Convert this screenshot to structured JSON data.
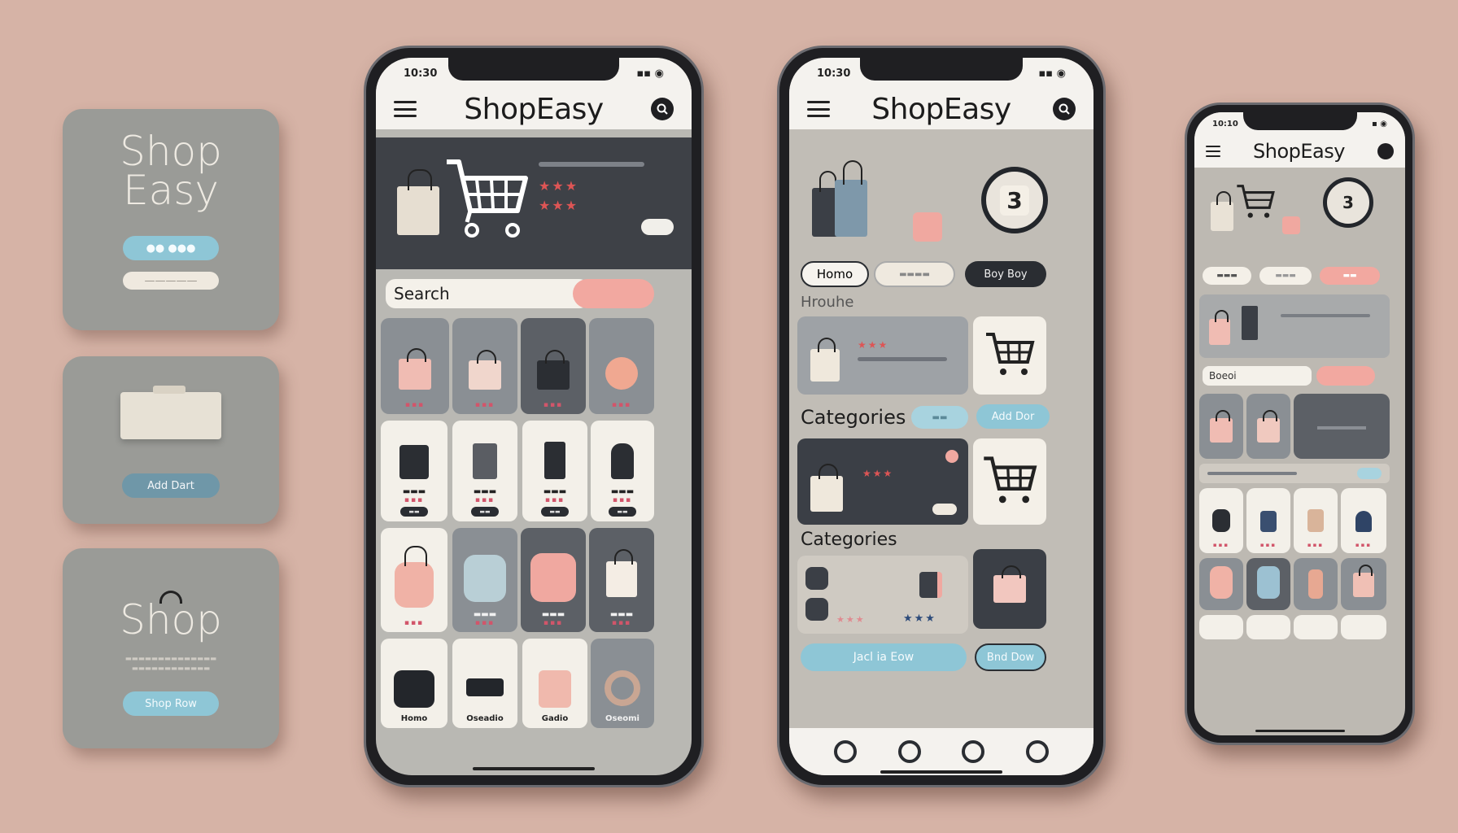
{
  "cards": [
    {
      "title_line1": "Shop",
      "title_line2": "Easy"
    },
    {
      "button": "Add Dart"
    },
    {
      "title": "Shop",
      "button": "Shop Row"
    }
  ],
  "phone1": {
    "time": "10:30",
    "brand": "ShopEasy",
    "search_placeholder": "Search",
    "tile_labels": [
      "Homo",
      "Oseadio",
      "Gadio",
      "Oseomi"
    ]
  },
  "phone2": {
    "time": "10:30",
    "brand": "ShopEasy",
    "chip_home": "Homo",
    "chip_buy": "Boy Boy",
    "section_hero": "Hrouhe",
    "section_categories": "Categories",
    "section_categories2": "Categories",
    "chip_add": "Add Dor",
    "badge_number": "3",
    "bottom_btn_left": "Jacl ia Eow",
    "bottom_btn_right": "Bnd Dow"
  },
  "phone3": {
    "time": "10:10",
    "brand": "ShopEasy",
    "search_placeholder": "Boeoi",
    "badge_number": "3"
  },
  "colors": {
    "background": "#d6b3a6",
    "accent_pink": "#f2a8a0",
    "accent_blue": "#8ec6d6",
    "dark": "#2a2d32"
  }
}
